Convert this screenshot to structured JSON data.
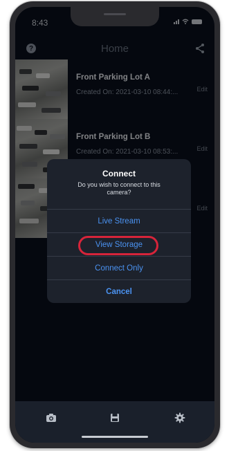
{
  "status_bar": {
    "time": "8:43"
  },
  "nav": {
    "title": "Home"
  },
  "cameras": [
    {
      "name": "Front Parking Lot A",
      "created": "Created On: 2021-03-10 08:44:...",
      "edit": "Edit"
    },
    {
      "name": "Front Parking Lot B",
      "created": "Created On: 2021-03-10 08:53:...",
      "edit": "Edit"
    },
    {
      "name": "",
      "created": "",
      "edit": "Edit"
    }
  ],
  "dialog": {
    "title": "Connect",
    "message": "Do you wish to connect to this camera?",
    "buttons": {
      "live_stream": "Live Stream",
      "view_storage": "View Storage",
      "connect_only": "Connect Only",
      "cancel": "Cancel"
    },
    "highlighted": "View Storage"
  },
  "tab_bar": {
    "items": [
      "camera-icon",
      "storage-icon",
      "settings-icon"
    ]
  },
  "colors": {
    "accent": "#4b93f2",
    "highlight": "#d7243a",
    "background": "#0a0f1c",
    "dialog": "#1d222c",
    "tab_bar": "#1a202b"
  }
}
